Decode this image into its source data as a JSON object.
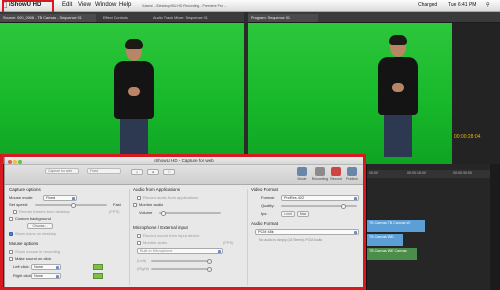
{
  "menubar": {
    "app_name": "iShowU HD",
    "items": [
      "Edit",
      "View",
      "Window",
      "Help"
    ],
    "path": "/Users/.../Desktop/iSU.HD Recording - Premiere Pro ...",
    "status": [
      "Charged",
      "Tue 6:41 PM"
    ]
  },
  "premiere": {
    "left_tabs": [
      "Source: 000_0008 - TB Canvas - Sequence 01",
      "Effect Controls",
      "Audio Track Mixer: Sequence 01"
    ],
    "right_tabs": [
      "Program: Sequence 01"
    ],
    "timecode": "00:00:28:04",
    "timeline_ruler": [
      "00:00",
      "00:00:15:00",
      "00:00:30:00"
    ],
    "clips": {
      "video_clip_1": "TB Canvas TB Canvas W.",
      "video_clip_2": "TB Canvas WE.",
      "audio_clip": "TB Canvas WE Canvas"
    }
  },
  "dialog": {
    "title": "iShowU HD - Capture for web",
    "toolbar": {
      "preset_field": "Capture for web",
      "size_field": "Fixed",
      "buttons": [
        "Mode",
        "Recording",
        "Record",
        "Publish"
      ]
    },
    "capture_options": {
      "heading": "Capture options",
      "mouse_mode_label": "Mouse mode:",
      "mouse_mode_value": "Fixed",
      "set_speed_label": "Set speed:",
      "set_speed_right": "Fast",
      "render_frames_label": "Render frames from desktop",
      "render_frames_right": "(FPS)",
      "custom_background_label": "Custom background",
      "choose_button": "Choose...",
      "show_icons_label": "Show icons on desktop"
    },
    "mouse_options": {
      "heading": "Mouse options",
      "show_mouse_label": "Show mouse in recording",
      "make_sound_label": "Make sound on click",
      "left_click_label": "Left click:",
      "left_click_value": "None",
      "right_click_label": "Right click:",
      "right_click_value": "None"
    },
    "audio_from_apps": {
      "heading": "Audio from Applications",
      "record_audio_label": "Record audio from applications",
      "monitor_audio_label": "Monitor audio",
      "volume_label": "Volume"
    },
    "mic_input": {
      "heading": "Microphone / External input",
      "record_mic_label": "Record sound from input device",
      "monitor_mic_label": "Monitor audio",
      "monitor_mic_right": "(FPS)",
      "device_value": "Built-in Microphone",
      "left_label": "(Left)",
      "right_label": "(Right)"
    },
    "video_format": {
      "heading": "Video Format",
      "format_label": "Format:",
      "format_value": "ProRes 422",
      "quality_label": "Quality:",
      "fps_label": "fps:",
      "fps_value": "Limit",
      "fps_extra": "Max"
    },
    "audio_format": {
      "heading": "Audio Format",
      "format_value": "PCM 48k",
      "note": "No audio is simply (24 Stereo) PCM Audio"
    }
  },
  "colors": {
    "highlight": "#d71920",
    "greenscreen": "#18b92b",
    "accent": "#4a7fd8"
  }
}
